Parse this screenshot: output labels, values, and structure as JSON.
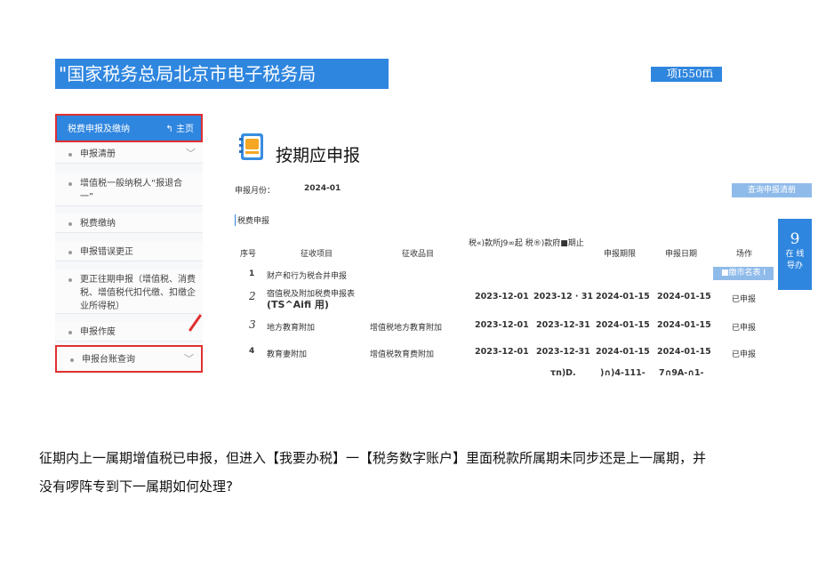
{
  "banner": {
    "title": "\"国家税务总局北京市电子税务局"
  },
  "top_right": {
    "text": "项I550ffi"
  },
  "sidebar": {
    "header_title": "税费申报及缴纳",
    "home_label": "主页",
    "items": [
      {
        "label": "申报清册",
        "has_chevron": true
      },
      {
        "label": "增值税一般纳税人“报退合一”"
      },
      {
        "label": "税费缴纳"
      },
      {
        "label": "申报错误更正"
      },
      {
        "label": "更正往期申报（增值税、消费税、增值税代扣代缴、扣缴企业所得税）"
      },
      {
        "label": "申报作废"
      },
      {
        "label": "申报台账查询",
        "has_chevron": true
      }
    ]
  },
  "page": {
    "title": "按期应申报",
    "month_label": "申报月份：",
    "month_value": "2024-01",
    "query_button": "查询申报清册",
    "section_title": "税费申报",
    "float_number": "9",
    "float_line1": "在 线",
    "float_line2": "导办"
  },
  "table": {
    "headers": {
      "seq": "序号",
      "item": "征收项目",
      "subitem": "征收品目",
      "period_combined": "税«)款所J9∞起 税®)款府■期止",
      "deadline": "申报期限",
      "date": "申报日期",
      "action": "场作"
    },
    "rows": [
      {
        "seq": "1",
        "item": "财产和行为税合并申报",
        "subitem": "",
        "start": "",
        "end": "",
        "deadline": "",
        "date": "",
        "action": "■缴市名表 I"
      },
      {
        "seq": "2",
        "item": "宿值税及附加税费申报表",
        "item_extra": "(TS^Aifi 用)",
        "subitem": "",
        "start": "2023-12-01",
        "end": "2023-12 · 31",
        "deadline": "2024-01-15",
        "date": "2024-01-15",
        "action": "已申报"
      },
      {
        "seq": "3",
        "item": "地方教育附加",
        "subitem": "增值税地方教育附加",
        "start": "2023-12-01",
        "end": "2023-12-31",
        "deadline": "2024-01-15",
        "date": "2024-01-15",
        "action": "已申报"
      },
      {
        "seq": "4",
        "item": "教育妻附加",
        "subitem": "增值税敦育费附加",
        "start": "2023-12-01",
        "end": "2023-12-31",
        "deadline": "2024-01-15",
        "date": "2024-01-15",
        "action": "已申报"
      }
    ],
    "garbled_row": [
      "τn)D.",
      ")∩)4-111-",
      "7∩9A-∩1-"
    ]
  },
  "question": {
    "line1": "征期内上一属期增值税已申报，但进入【我要办税】一【税务数字账户】里面税款所属期未同步还是上一属期，并",
    "line2": "没有啰阵专到下一属期如何处理?"
  },
  "colors": {
    "brand_blue": "#2f86df",
    "light_blue": "#8fbbea",
    "highlight_red": "#e03030"
  }
}
